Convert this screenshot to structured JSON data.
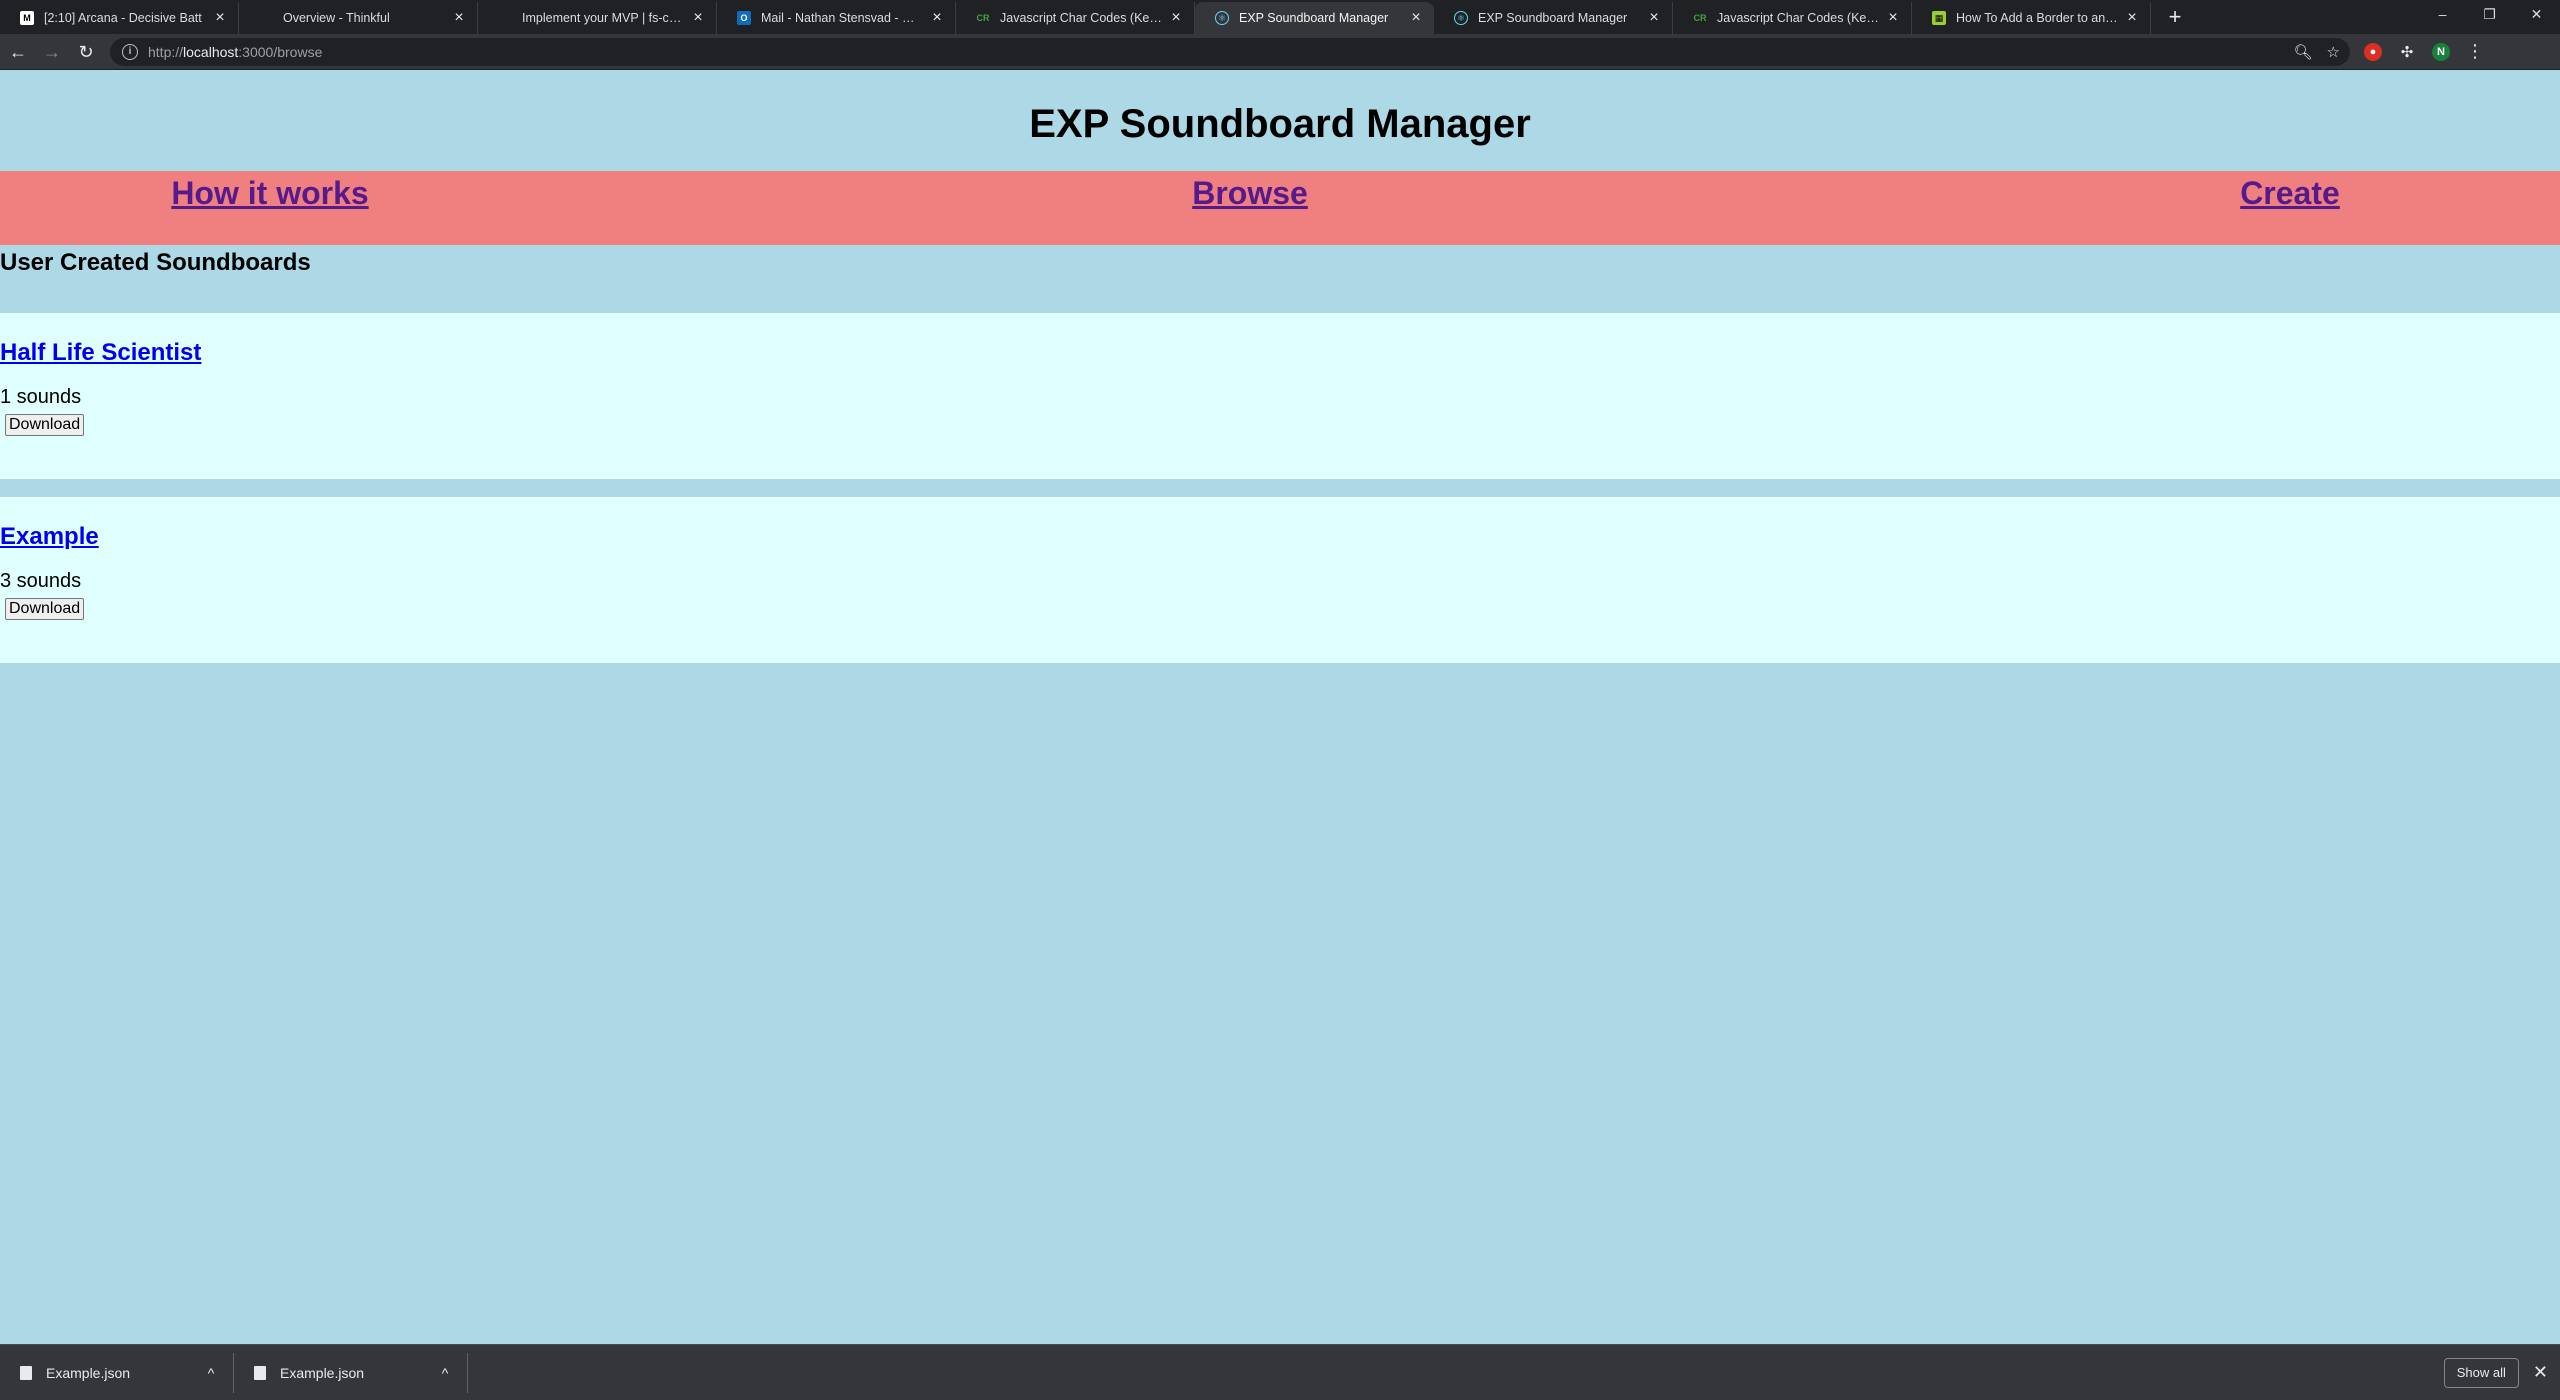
{
  "tabs": [
    {
      "title": "[2:10] Arcana - Decisive Batt",
      "favicon_color": "#ffffff"
    },
    {
      "title": "Overview - Thinkful",
      "favicon_color": "#202124"
    },
    {
      "title": "Implement your MVP | fs-capsto",
      "favicon_color": "#202124"
    },
    {
      "title": "Mail - Nathan Stensvad - Outlo",
      "favicon_color": "#0f6cbd"
    },
    {
      "title": "Javascript Char Codes (Key Code",
      "favicon_color": "#44a340"
    },
    {
      "title": "EXP Soundboard Manager",
      "favicon_color": "#61dafb"
    },
    {
      "title": "EXP Soundboard Manager",
      "favicon_color": "#61dafb"
    },
    {
      "title": "Javascript Char Codes (Key Code",
      "favicon_color": "#44a340"
    },
    {
      "title": "How To Add a Border to an Imag",
      "favicon_color": "#9acd32"
    }
  ],
  "active_tab_index": 5,
  "address_bar": {
    "scheme": "http://",
    "host": "localhost",
    "path": ":3000/browse"
  },
  "profile_initial": "N",
  "page": {
    "title": "EXP Soundboard Manager",
    "nav": {
      "how_it_works": "How it works",
      "browse": "Browse",
      "create": "Create"
    },
    "section_heading": "User Created Soundboards",
    "soundboards": [
      {
        "name": "Half Life Scientist",
        "count": "1 sounds",
        "button": "Download"
      },
      {
        "name": "Example",
        "count": "3 sounds",
        "button": "Download"
      }
    ]
  },
  "downloads": [
    {
      "file": "Example.json"
    },
    {
      "file": "Example.json"
    }
  ],
  "show_all_label": "Show all",
  "colors": {
    "page_bg": "#add8e6",
    "nav_bg": "#f08080",
    "card_bg": "#e0ffff"
  }
}
